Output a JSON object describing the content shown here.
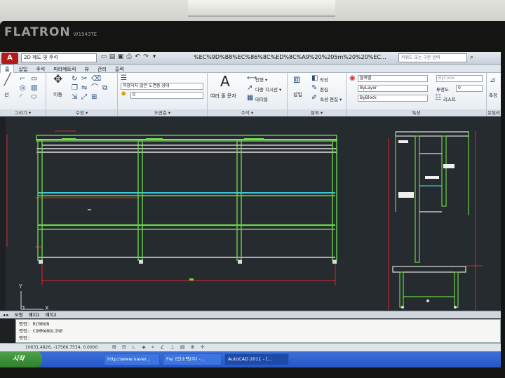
{
  "monitor": {
    "brand": "FLATRON",
    "model": "W1943TE"
  },
  "titlebar": {
    "app_letter": "A",
    "workspace": "2D 제도 및 주석",
    "document_title": "%EC%9D%B8%EC%86%8C%ED%8C%A9%20%205m%20%20%EC...",
    "search_placeholder": "키워드 또는 구문 입력"
  },
  "tabs": [
    "홈",
    "삽입",
    "주석",
    "파라메트릭",
    "뷰",
    "관리",
    "출력"
  ],
  "ribbon": {
    "draw": {
      "line_label": "선",
      "panel_label": "그리기 ▾"
    },
    "modify": {
      "move_label": "이동",
      "panel_label": "수정 ▾"
    },
    "layers": {
      "state_combo": "저장되지 않은 도면층 상태",
      "layer_combo": "0",
      "panel_label": "도면층 ▾"
    },
    "annotation": {
      "text_label": "여러 줄 문자",
      "linear_label": "선형 ▾",
      "multileader_label": "다중 지시선 ▾",
      "table_label": "테이블",
      "panel_label": "주석 ▾"
    },
    "block": {
      "insert_label": "삽입",
      "create_label": "작성",
      "edit_label": "편집",
      "attr_label": "속성 편집 ▾",
      "panel_label": "블록 ▾"
    },
    "properties": {
      "color_combo": "블록별",
      "linetype_combo": "ByLayer",
      "lineweight_combo": "ByBlock",
      "transparency_label": "투명도",
      "transparency_value": "0",
      "list_label": "리스트",
      "bycolor": "ByColor",
      "panel_label": "특성"
    },
    "utilities": {
      "measure_label": "측정",
      "panel_label": "유틸리티"
    }
  },
  "layout_tabs": [
    "모형",
    "배치1",
    "배치2"
  ],
  "command": {
    "line1": "명령: RIBBON",
    "line2": "명령: COMMANDLINE",
    "prompt": "명령:"
  },
  "status": {
    "coords": "10631.4826, -17566.7534, 0.0000"
  },
  "taskbar": {
    "start_label": "시작",
    "tasks": [
      "http://www.naver...",
      "Fw: [인소팩(주) -...",
      "AutoCAD 2011 - [..."
    ]
  },
  "drawing": {
    "ucs_x": "X",
    "ucs_y": "Y"
  },
  "colors": {
    "accent": "#b31a1a",
    "frame_green": "#6bd44a",
    "dim_red": "#d62a2a",
    "cyan": "#39c6d8",
    "canvas": "#262b2f"
  }
}
